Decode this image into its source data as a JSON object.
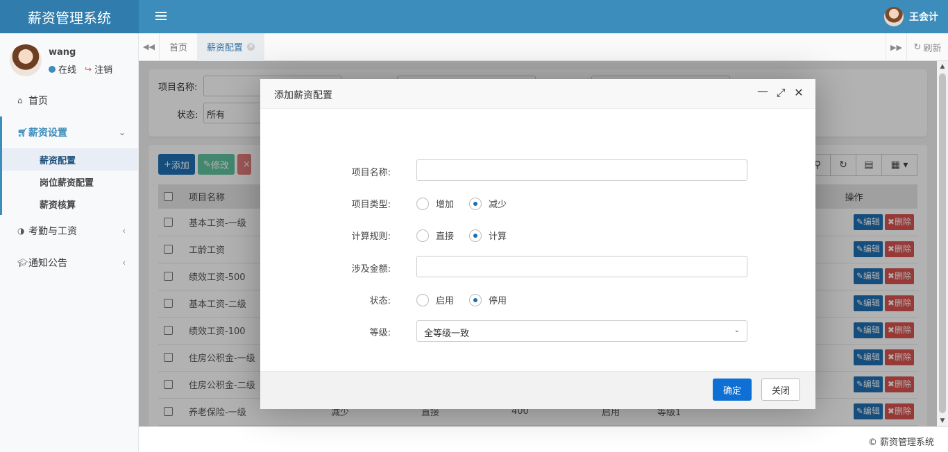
{
  "app": {
    "brand": "薪资管理系统",
    "current_user": "王会计"
  },
  "sidebar": {
    "user": {
      "name": "wang",
      "status": "在线",
      "logout": "注销"
    },
    "items": [
      {
        "label": "首页",
        "icon": "home-icon"
      },
      {
        "label": "薪资设置",
        "icon": "cart-icon",
        "expanded": true
      },
      {
        "label": "考勤与工资",
        "icon": "half-circle-icon"
      },
      {
        "label": "通知公告",
        "icon": "graduation-cap-icon"
      }
    ],
    "subitems": [
      "薪资配置",
      "岗位薪资配置",
      "薪资核算"
    ]
  },
  "tabs": {
    "home": "首页",
    "active": "薪资配置",
    "refresh": "刷新"
  },
  "search": {
    "name_label": "项目名称:",
    "status_label": "状态:",
    "status_value": "所有"
  },
  "toolbar": {
    "add": "添加",
    "edit": "修改"
  },
  "table": {
    "headers": {
      "name": "项目名称",
      "ops": "操作"
    },
    "rows": [
      "基本工资-一级",
      "工龄工资",
      "绩效工资-500",
      "基本工资-二级",
      "绩效工资-100",
      "住房公积金-一级",
      "住房公积金-二级",
      "养老保险-一级"
    ],
    "last_row_extra": {
      "type": "减少",
      "rule": "直接",
      "amount": "400",
      "status": "启用",
      "level": "等级1"
    },
    "edit_btn": "编辑",
    "delete_btn": "删除"
  },
  "modal": {
    "title": "添加薪资配置",
    "fields": {
      "name_label": "项目名称:",
      "type_label": "项目类型:",
      "type_options": [
        "增加",
        "减少"
      ],
      "type_selected": "减少",
      "rule_label": "计算规则:",
      "rule_options": [
        "直接",
        "计算"
      ],
      "rule_selected": "计算",
      "amount_label": "涉及金额:",
      "status_label": "状态:",
      "status_options": [
        "启用",
        "停用"
      ],
      "status_selected": "停用",
      "level_label": "等级:",
      "level_value": "全等级一致"
    },
    "ok": "确定",
    "cancel": "关闭"
  },
  "footer": {
    "text": "© 薪资管理系统"
  }
}
